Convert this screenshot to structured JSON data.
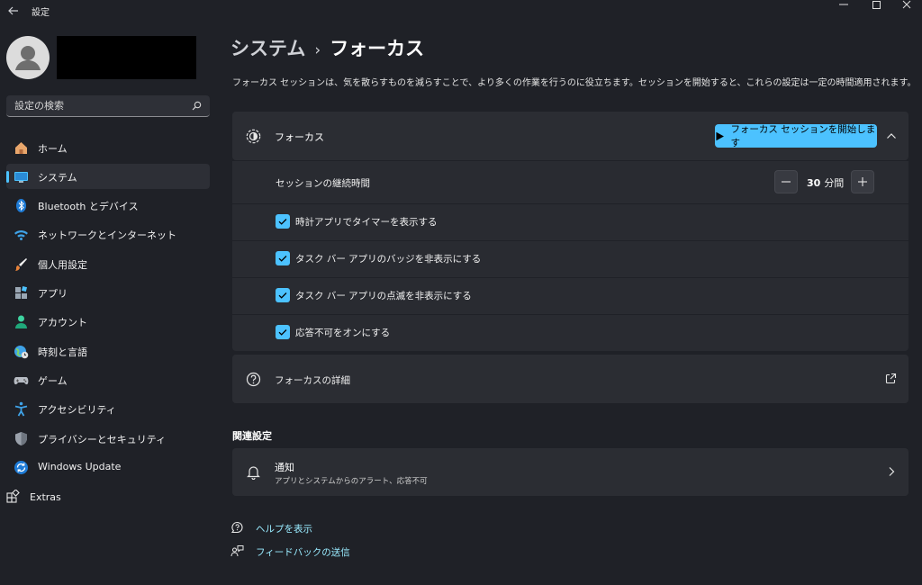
{
  "window": {
    "title": "設定",
    "controls": {
      "minimize": "minimize-icon",
      "maximize": "maximize-icon",
      "close": "close-icon"
    }
  },
  "user": {
    "avatar": "person-icon"
  },
  "search": {
    "placeholder": "設定の検索",
    "value": ""
  },
  "sidebar": {
    "items": [
      {
        "label": "ホーム",
        "icon": "home-icon"
      },
      {
        "label": "システム",
        "icon": "monitor-icon",
        "active": true
      },
      {
        "label": "Bluetooth とデバイス",
        "icon": "bluetooth-icon"
      },
      {
        "label": "ネットワークとインターネット",
        "icon": "wifi-icon"
      },
      {
        "label": "個人用設定",
        "icon": "brush-icon"
      },
      {
        "label": "アプリ",
        "icon": "apps-icon"
      },
      {
        "label": "アカウント",
        "icon": "account-icon"
      },
      {
        "label": "時刻と言語",
        "icon": "globe-clock-icon"
      },
      {
        "label": "ゲーム",
        "icon": "gamepad-icon"
      },
      {
        "label": "アクセシビリティ",
        "icon": "accessibility-icon"
      },
      {
        "label": "プライバシーとセキュリティ",
        "icon": "shield-icon"
      },
      {
        "label": "Windows Update",
        "icon": "update-icon"
      }
    ],
    "extras": {
      "label": "Extras",
      "icon": "extras-icon"
    }
  },
  "breadcrumb": {
    "parent": "システム",
    "separator": "›",
    "current": "フォーカス"
  },
  "description": "フォーカス セッションは、気を散らすものを減らすことで、より多くの作業を行うのに役立ちます。セッションを開始すると、これらの設定は一定の時間適用されます。",
  "focus": {
    "title": "フォーカス",
    "start_button": "フォーカス セッションを開始します",
    "expanded": true,
    "duration": {
      "label": "セッションの継続時間",
      "value": "30",
      "unit": "分間"
    },
    "options": [
      {
        "label": "時計アプリでタイマーを表示する",
        "checked": true
      },
      {
        "label": "タスク バー アプリのバッジを非表示にする",
        "checked": true
      },
      {
        "label": "タスク バー アプリの点滅を非表示にする",
        "checked": true
      },
      {
        "label": "応答不可をオンにする",
        "checked": true
      }
    ]
  },
  "details": {
    "label": "フォーカスの詳細"
  },
  "related": {
    "heading": "関連設定",
    "notifications": {
      "title": "通知",
      "subtitle": "アプリとシステムからのアラート、応答不可"
    }
  },
  "links": {
    "help": "ヘルプを表示",
    "feedback": "フィードバックの送信"
  },
  "colors": {
    "background": "#1f2127",
    "card": "#2b2d33",
    "accent": "#4cc2ff",
    "link": "#99ebff"
  }
}
